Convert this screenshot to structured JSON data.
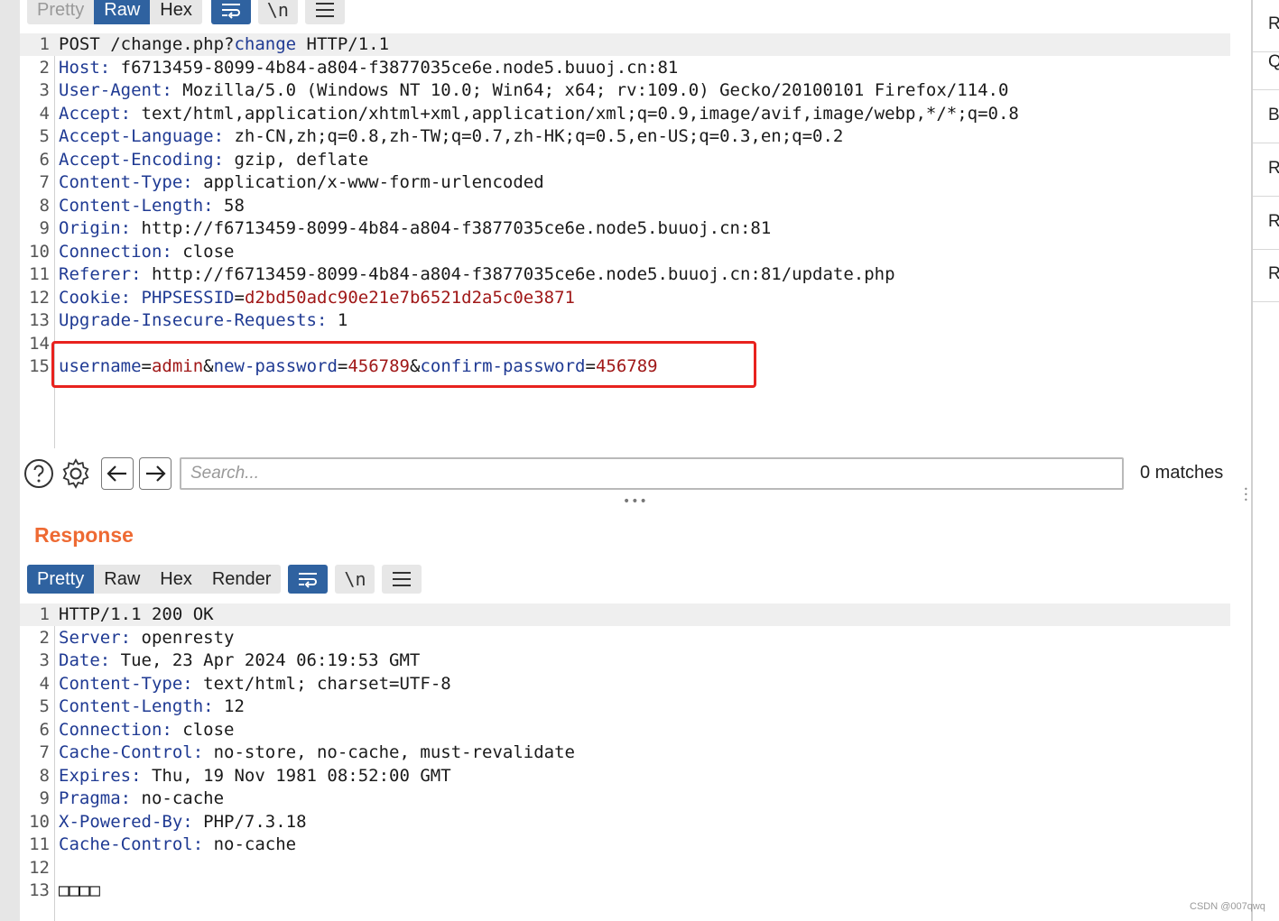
{
  "request": {
    "tabs": [
      {
        "label": "Pretty",
        "active": false
      },
      {
        "label": "Raw",
        "active": true
      },
      {
        "label": "Hex",
        "active": false
      }
    ],
    "icons": [
      "wrap-icon",
      "newline-icon",
      "menu-icon"
    ],
    "newline_label": "\\n",
    "lines": [
      {
        "n": "1",
        "parts": [
          {
            "t": "POST /change.php?",
            "c": "v"
          },
          {
            "t": "change",
            "c": "k"
          },
          {
            "t": " HTTP/1.1",
            "c": "v"
          }
        ]
      },
      {
        "n": "2",
        "parts": [
          {
            "t": "Host:",
            "c": "k"
          },
          {
            "t": " f6713459-8099-4b84-a804-f3877035ce6e.node5.buuoj.cn:81",
            "c": "v"
          }
        ]
      },
      {
        "n": "3",
        "parts": [
          {
            "t": "User-Agent:",
            "c": "k"
          },
          {
            "t": " Mozilla/5.0 (Windows NT 10.0; Win64; x64; rv:109.0) Gecko/20100101 Firefox/114.0",
            "c": "v"
          }
        ]
      },
      {
        "n": "4",
        "parts": [
          {
            "t": "Accept:",
            "c": "k"
          },
          {
            "t": " text/html,application/xhtml+xml,application/xml;q=0.9,image/avif,image/webp,*/*;q=0.8",
            "c": "v"
          }
        ]
      },
      {
        "n": "5",
        "parts": [
          {
            "t": "Accept-Language:",
            "c": "k"
          },
          {
            "t": " zh-CN,zh;q=0.8,zh-TW;q=0.7,zh-HK;q=0.5,en-US;q=0.3,en;q=0.2",
            "c": "v"
          }
        ]
      },
      {
        "n": "6",
        "parts": [
          {
            "t": "Accept-Encoding:",
            "c": "k"
          },
          {
            "t": " gzip, deflate",
            "c": "v"
          }
        ]
      },
      {
        "n": "7",
        "parts": [
          {
            "t": "Content-Type:",
            "c": "k"
          },
          {
            "t": " application/x-www-form-urlencoded",
            "c": "v"
          }
        ]
      },
      {
        "n": "8",
        "parts": [
          {
            "t": "Content-Length:",
            "c": "k"
          },
          {
            "t": " 58",
            "c": "v"
          }
        ]
      },
      {
        "n": "9",
        "parts": [
          {
            "t": "Origin:",
            "c": "k"
          },
          {
            "t": " http://f6713459-8099-4b84-a804-f3877035ce6e.node5.buuoj.cn:81",
            "c": "v"
          }
        ]
      },
      {
        "n": "10",
        "parts": [
          {
            "t": "Connection:",
            "c": "k"
          },
          {
            "t": " close",
            "c": "v"
          }
        ]
      },
      {
        "n": "11",
        "parts": [
          {
            "t": "Referer:",
            "c": "k"
          },
          {
            "t": " http://f6713459-8099-4b84-a804-f3877035ce6e.node5.buuoj.cn:81/update.php",
            "c": "v"
          }
        ]
      },
      {
        "n": "12",
        "parts": [
          {
            "t": "Cookie:",
            "c": "k"
          },
          {
            "t": " ",
            "c": "v"
          },
          {
            "t": "PHPSESSID",
            "c": "k"
          },
          {
            "t": "=",
            "c": "v"
          },
          {
            "t": "d2bd50adc90e21e7b6521d2a5c0e3871",
            "c": "r"
          }
        ]
      },
      {
        "n": "13",
        "parts": [
          {
            "t": "Upgrade-Insecure-Requests:",
            "c": "k"
          },
          {
            "t": " 1",
            "c": "v"
          }
        ]
      },
      {
        "n": "14",
        "parts": []
      },
      {
        "n": "15",
        "parts": [
          {
            "t": "username",
            "c": "k"
          },
          {
            "t": "=",
            "c": "v"
          },
          {
            "t": "admin",
            "c": "r"
          },
          {
            "t": "&",
            "c": "v"
          },
          {
            "t": "new-password",
            "c": "k"
          },
          {
            "t": "=",
            "c": "v"
          },
          {
            "t": "456789",
            "c": "r"
          },
          {
            "t": "&",
            "c": "v"
          },
          {
            "t": "confirm-password",
            "c": "k"
          },
          {
            "t": "=",
            "c": "v"
          },
          {
            "t": "456789",
            "c": "r"
          }
        ]
      }
    ]
  },
  "search": {
    "placeholder": "Search...",
    "value": "",
    "matches": "0 matches"
  },
  "response": {
    "title": "Response",
    "tabs": [
      {
        "label": "Pretty",
        "active": true
      },
      {
        "label": "Raw",
        "active": false
      },
      {
        "label": "Hex",
        "active": false
      },
      {
        "label": "Render",
        "active": false
      }
    ],
    "newline_label": "\\n",
    "lines": [
      {
        "n": "1",
        "parts": [
          {
            "t": "HTTP/1.1 200 OK",
            "c": "v"
          }
        ]
      },
      {
        "n": "2",
        "parts": [
          {
            "t": "Server:",
            "c": "k"
          },
          {
            "t": " openresty",
            "c": "v"
          }
        ]
      },
      {
        "n": "3",
        "parts": [
          {
            "t": "Date:",
            "c": "k"
          },
          {
            "t": " Tue, 23 Apr 2024 06:19:53 GMT",
            "c": "v"
          }
        ]
      },
      {
        "n": "4",
        "parts": [
          {
            "t": "Content-Type:",
            "c": "k"
          },
          {
            "t": " text/html; charset=UTF-8",
            "c": "v"
          }
        ]
      },
      {
        "n": "5",
        "parts": [
          {
            "t": "Content-Length:",
            "c": "k"
          },
          {
            "t": " 12",
            "c": "v"
          }
        ]
      },
      {
        "n": "6",
        "parts": [
          {
            "t": "Connection:",
            "c": "k"
          },
          {
            "t": " close",
            "c": "v"
          }
        ]
      },
      {
        "n": "7",
        "parts": [
          {
            "t": "Cache-Control:",
            "c": "k"
          },
          {
            "t": " no-store, no-cache, must-revalidate",
            "c": "v"
          }
        ]
      },
      {
        "n": "8",
        "parts": [
          {
            "t": "Expires:",
            "c": "k"
          },
          {
            "t": " Thu, 19 Nov 1981 08:52:00 GMT",
            "c": "v"
          }
        ]
      },
      {
        "n": "9",
        "parts": [
          {
            "t": "Pragma:",
            "c": "k"
          },
          {
            "t": " no-cache",
            "c": "v"
          }
        ]
      },
      {
        "n": "10",
        "parts": [
          {
            "t": "X-Powered-By:",
            "c": "k"
          },
          {
            "t": " PHP/7.3.18",
            "c": "v"
          }
        ]
      },
      {
        "n": "11",
        "parts": [
          {
            "t": "Cache-Control:",
            "c": "k"
          },
          {
            "t": " no-cache",
            "c": "v"
          }
        ]
      },
      {
        "n": "12",
        "parts": []
      },
      {
        "n": "13",
        "parts": [
          {
            "t": "□□□□",
            "c": "box"
          }
        ]
      }
    ]
  },
  "side_panel": {
    "items": [
      "R",
      "Q",
      "B",
      "R",
      "R",
      "R"
    ]
  },
  "watermark": "CSDN @007qwq",
  "colors": {
    "accent_blue": "#2f62a0",
    "header_key": "#1f3a93",
    "value_red": "#a01818",
    "response_title": "#ee6a33",
    "highlight_box": "#e8221e"
  }
}
